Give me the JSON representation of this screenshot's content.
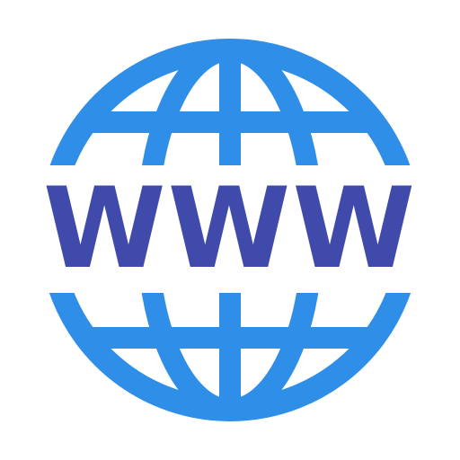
{
  "icon": {
    "name": "www-globe-icon",
    "text": "WWW",
    "colors": {
      "globe": "#2f8ee8",
      "text": "#3f4aab",
      "background": "#ffffff"
    }
  }
}
